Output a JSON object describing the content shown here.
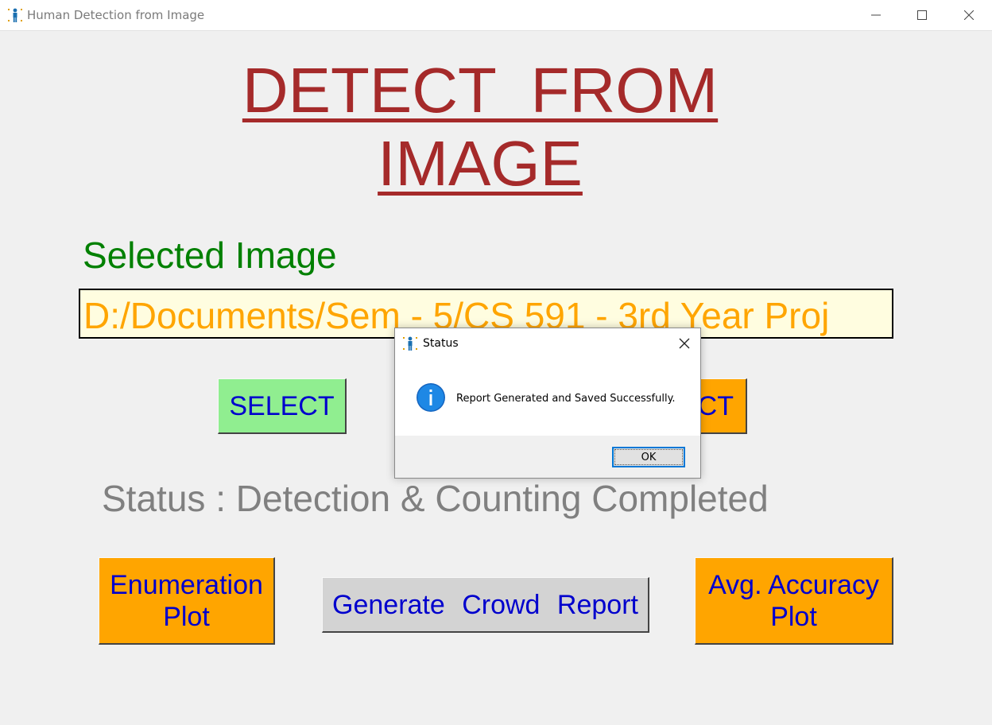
{
  "window": {
    "title": "Human Detection from Image",
    "icon": "person-icon"
  },
  "header": {
    "line1": "DETECT FROM",
    "line2": "IMAGE",
    "color": "#a52a2a"
  },
  "selected_image": {
    "label": "Selected Image",
    "path": "D:/Documents/Sem - 5/CS 591 - 3rd Year Proj"
  },
  "buttons": {
    "select": "SELECT",
    "detect_visible": "CT",
    "enumeration_plot": "Enumeration Plot",
    "generate_report": "Generate Crowd Report",
    "avg_accuracy_plot": "Avg. Accuracy Plot"
  },
  "status": {
    "text": "Status : Detection & Counting Completed"
  },
  "dialog": {
    "title": "Status",
    "message": "Report Generated and Saved Successfully.",
    "ok_label": "OK",
    "icon": "info-icon"
  },
  "colors": {
    "select_bg": "#90ee90",
    "orange_bg": "#ffa500",
    "report_bg": "#d3d3d3",
    "button_text": "#0000cd",
    "label_green": "#008000",
    "path_text": "#ffa500",
    "status_text": "#808080"
  }
}
